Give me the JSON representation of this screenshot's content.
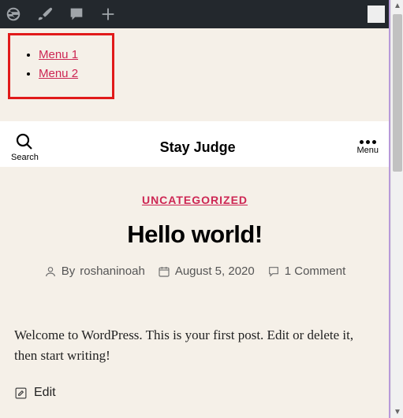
{
  "admin_bar": {
    "dashboard_icon": "dashboard-icon",
    "customize_icon": "brush-icon",
    "comments_icon": "speech-icon",
    "new_icon": "plus-icon",
    "avatar": "user-avatar"
  },
  "highlighted_menu": {
    "items": [
      {
        "label": "Menu 1"
      },
      {
        "label": "Menu 2"
      }
    ]
  },
  "header": {
    "search_label": "Search",
    "site_title": "Stay Judge",
    "menu_label": "Menu"
  },
  "post": {
    "category": "UNCATEGORIZED",
    "title": "Hello world!",
    "author_prefix": "By",
    "author": "roshaninoah",
    "date": "August 5, 2020",
    "comments": "1 Comment",
    "body": "Welcome to WordPress. This is your first post. Edit or delete it, then start writing!",
    "edit_label": "Edit"
  }
}
